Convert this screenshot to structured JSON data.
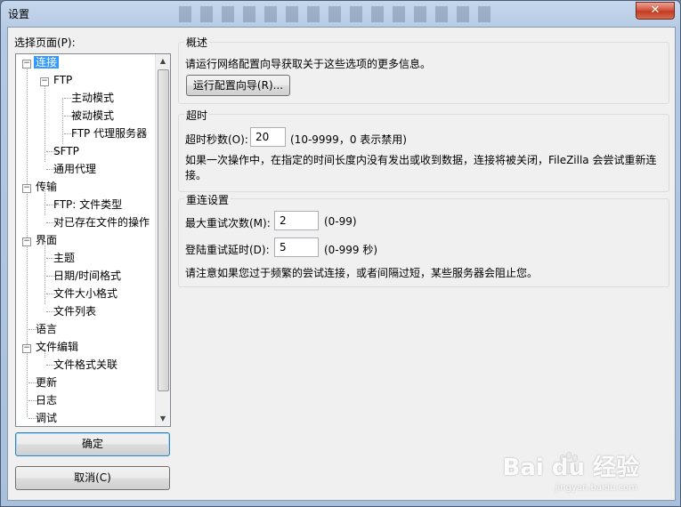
{
  "window": {
    "title": "设置",
    "close_glyph": "✕"
  },
  "tree": {
    "label": "选择页面(P):",
    "items": [
      {
        "label": "连接",
        "expander": "−"
      },
      {
        "label": "FTP",
        "expander": "−"
      },
      {
        "label": "主动模式"
      },
      {
        "label": "被动模式"
      },
      {
        "label": "FTP 代理服务器"
      },
      {
        "label": "SFTP"
      },
      {
        "label": "通用代理"
      },
      {
        "label": "传输",
        "expander": "−"
      },
      {
        "label": "FTP: 文件类型"
      },
      {
        "label": "对已存在文件的操作"
      },
      {
        "label": "界面",
        "expander": "−"
      },
      {
        "label": "主题"
      },
      {
        "label": "日期/时间格式"
      },
      {
        "label": "文件大小格式"
      },
      {
        "label": "文件列表"
      },
      {
        "label": "语言"
      },
      {
        "label": "文件编辑",
        "expander": "−"
      },
      {
        "label": "文件格式关联"
      },
      {
        "label": "更新"
      },
      {
        "label": "日志"
      },
      {
        "label": "调试"
      }
    ],
    "selected": "连接",
    "scroll_up": "▲",
    "scroll_down": "▼"
  },
  "buttons": {
    "ok": "确定",
    "cancel": "取消(C)"
  },
  "overview": {
    "title": "概述",
    "text": "请运行网络配置向导获取关于这些选项的更多信息。",
    "wizard_button": "运行配置向导(R)..."
  },
  "timeout": {
    "title": "超时",
    "seconds_label": "超时秒数(O):",
    "seconds_value": "20",
    "seconds_hint": "(10-9999，0 表示禁用)",
    "description": "如果一次操作中，在指定的时间长度内没有发出或收到数据，连接将被关闭，FileZilla 会尝试重新连接。"
  },
  "reconnect": {
    "title": "重连设置",
    "retries_label": "最大重试次数(M):",
    "retries_value": "2",
    "retries_hint": "(0-99)",
    "delay_label": "登陆重试延时(D):",
    "delay_value": "5",
    "delay_hint": "(0-999 秒)",
    "note": "请注意如果您过于频繁的尝试连接，或者间隔过短，某些服务器会阻止您。"
  },
  "watermark": {
    "text": "Bai du 经验",
    "sub": "jingyan.baidu.com"
  }
}
